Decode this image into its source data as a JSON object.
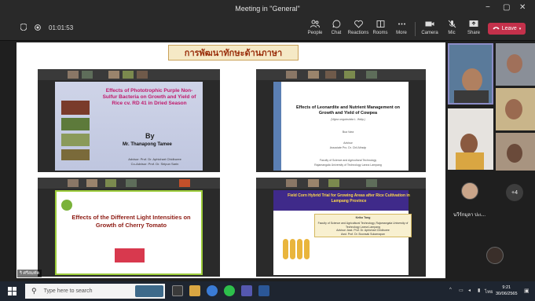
{
  "window": {
    "title": "Meeting in \"General\"",
    "minimize": "−",
    "maximize": "▢",
    "close": "✕"
  },
  "toolbar": {
    "timer": "01:01:53",
    "people": "People",
    "chat": "Chat",
    "reactions": "Reactions",
    "rooms": "Rooms",
    "more": "More",
    "camera": "Camera",
    "mic": "Mic",
    "share": "Share",
    "leave": "Leave"
  },
  "slide": {
    "title": "การพัฒนาทักษะด้านภาษา",
    "thumb1": {
      "title": "Effects of Phototrophic Purple Non-Sulfur Bacteria on Growth and Yield of Rice cv. RD 41 in Dried Season",
      "by": "By",
      "name": "Mr. Thanapong Tamee",
      "advisor": "Advisor: Prof. Dr. Aphichart Chidburee",
      "coadvisor": "Co-Advisor: Prof. Dr. Siripun Sarin"
    },
    "thumb2": {
      "title": "Effects of Leonardite and Nutrient Management on Growth and Yield of Cowpea",
      "latin": "(Vigna unguiculata L. Walp.)",
      "author": "Bua Vara",
      "advisor_label": "Advisor",
      "advisor": "Associate Pro. Dr. Chil Aihsdp",
      "faculty": "Faculty of Science and Agricultural Technology",
      "university": "Rajamangala University of Technology Lanna Lampang"
    },
    "thumb3": {
      "title": "Effects of the Different Light Intensities on Growth of Cherry Tomato"
    },
    "thumb4": {
      "title": "Field Corn Hybrid Trial for Growing Areas after Rice Cultivation in Lampang Province",
      "author": "Keiko Tong",
      "faculty": "Faculty of Science and Agricultural Technology, Rajamangala University of Technology Lanna Lampang",
      "advisor": "Advisor: Asst. Prof. Dr. Aphichart Chidburee",
      "coadvisor": "Asst. Prof. Dr. Boonsak Sukarnapan"
    }
  },
  "participants": {
    "named": "นวีร์กมุลา ปะเ...",
    "overflow": "+4",
    "self_label": "ริ ศรีสมทัต"
  },
  "taskbar": {
    "search_placeholder": "Type here to search",
    "time": "9:21",
    "date": "30/06/2565",
    "lang": "ไทย"
  },
  "colors": {
    "leave": "#c4314b",
    "accent": "#6264a7",
    "title_bg": "#f5e9c6"
  }
}
